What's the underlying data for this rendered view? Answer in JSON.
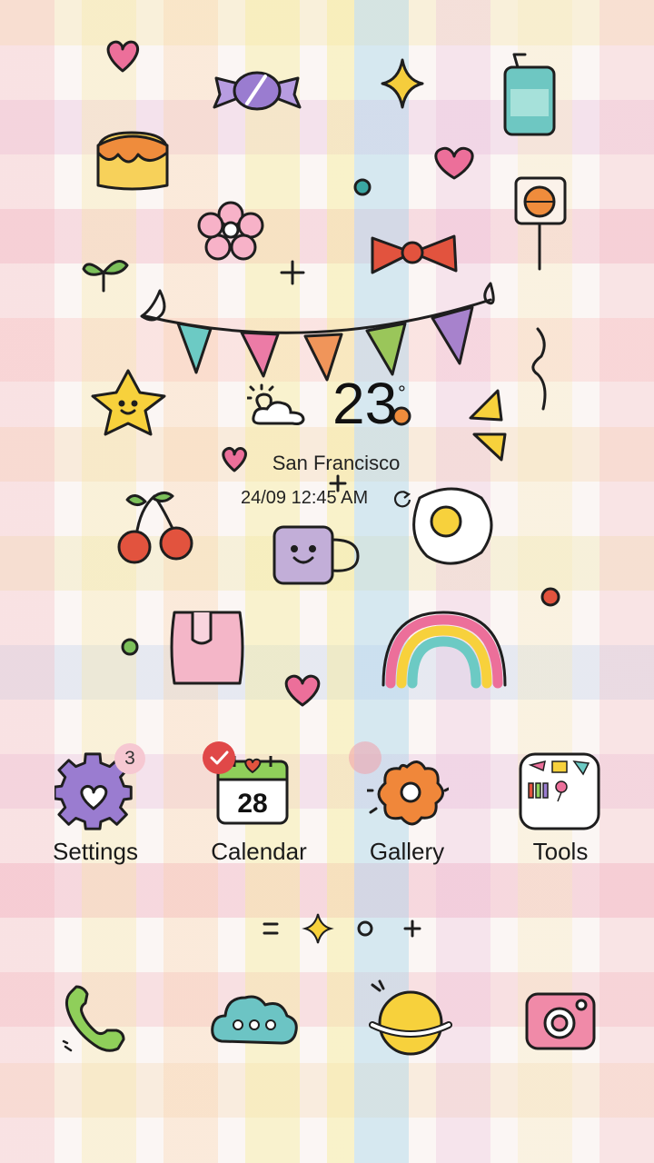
{
  "weather": {
    "temperature": "23",
    "unit": "°",
    "location": "San Francisco",
    "datetime": "24/09 12:45 AM",
    "condition_icon": "partly-cloudy-icon",
    "refresh_icon": "refresh-icon"
  },
  "apps": [
    {
      "label": "Settings",
      "icon": "gear-heart-icon",
      "badge": "3"
    },
    {
      "label": "Calendar",
      "icon": "calendar-icon",
      "day": "28",
      "badge_icon": "check-icon"
    },
    {
      "label": "Gallery",
      "icon": "flower-icon",
      "badge_icon": "dot"
    },
    {
      "label": "Tools",
      "icon": "toolbox-icon"
    }
  ],
  "page_indicator": {
    "icons": [
      "menu-lines-icon",
      "sparkle-icon",
      "circle-icon",
      "plus-icon"
    ]
  },
  "dock": [
    {
      "icon": "phone-icon"
    },
    {
      "icon": "message-cloud-icon"
    },
    {
      "icon": "planet-icon"
    },
    {
      "icon": "camera-icon"
    }
  ],
  "colors": {
    "badge_red": "#e04848",
    "badge_pink": "#f6c8d2",
    "text": "#1a1a1a"
  }
}
